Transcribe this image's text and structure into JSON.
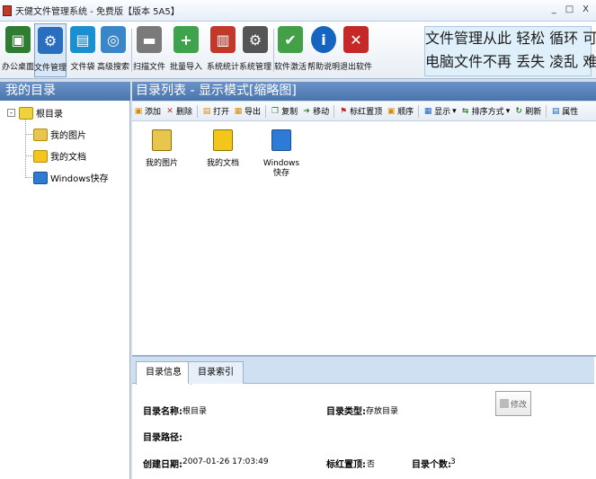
{
  "window": {
    "title": "天健文件管理系统 - 免费版【版本 5A5】",
    "controls": [
      "_",
      "□",
      "X"
    ]
  },
  "toolbar": {
    "buttons": [
      {
        "label": "办公桌面",
        "icon": "desk-icon",
        "color": "#2e7d32"
      },
      {
        "label": "文件管理",
        "icon": "file-manage-icon",
        "color": "#2a6fbf"
      },
      {
        "label": "文件袋",
        "icon": "file-bag-icon",
        "color": "#1c8fd1"
      },
      {
        "label": "高级搜索",
        "icon": "search-globe-icon",
        "color": "#3a86c8"
      },
      {
        "label": "扫描文件",
        "icon": "scanner-icon",
        "color": "#7a7a7a"
      },
      {
        "label": "批量导入",
        "icon": "import-icon",
        "color": "#3fa34d"
      },
      {
        "label": "系统统计",
        "icon": "chart-icon",
        "color": "#c0392b"
      },
      {
        "label": "系统管理",
        "icon": "gear-icon",
        "color": "#555555"
      },
      {
        "label": "软件激活",
        "icon": "activate-icon",
        "color": "#43a047"
      },
      {
        "label": "帮助说明",
        "icon": "help-icon",
        "color": "#1565c0"
      },
      {
        "label": "退出软件",
        "icon": "exit-icon",
        "color": "#c62828"
      }
    ],
    "slogan_line1": "文件管理从此 轻松 循环 可靠",
    "slogan_line2": "电脑文件不再 丢失 凌乱 难找"
  },
  "left_pane": {
    "header": "我的目录",
    "root": "根目录",
    "items": [
      "我的图片",
      "我的文档",
      "Windows快存"
    ]
  },
  "right_pane": {
    "header": "目录列表 - 显示模式[缩略图]",
    "toolbar": [
      "添加",
      "删除",
      "打开",
      "导出",
      "复制",
      "移动",
      "标红置顶",
      "顺序",
      "显示",
      "排序方式",
      "刷新",
      "属性"
    ],
    "thumbnails": [
      "我的图片",
      "我的文档",
      "Windows快存"
    ]
  },
  "info": {
    "tabs": [
      "目录信息",
      "目录索引"
    ],
    "name_label": "目录名称:",
    "name_value": "根目录",
    "type_label": "目录类型:",
    "type_value": "存放目录",
    "path_label": "目录路径:",
    "path_value": "",
    "created_label": "创建日期:",
    "created_value": "2007-01-26 17:03:49",
    "pin_label": "标红置顶:",
    "pin_value": "否",
    "count_label": "目录个数:",
    "count_value": "3",
    "modify_label": "修改"
  }
}
